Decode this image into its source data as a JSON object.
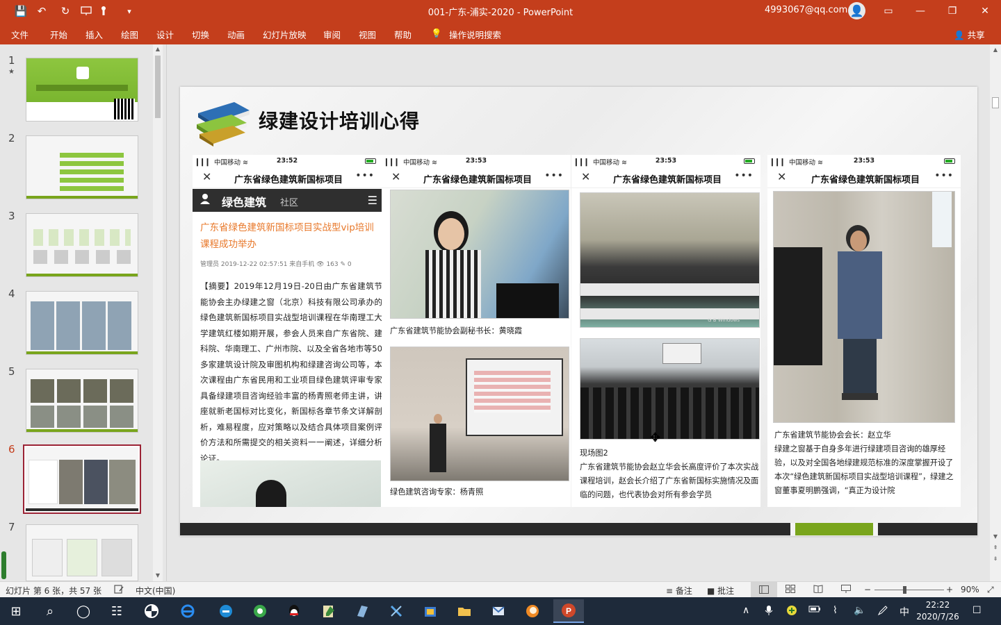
{
  "titlebar": {
    "doc_title": "001-广东-浦实-2020  -  PowerPoint",
    "account": "4993067@qq.com",
    "save_icon": "💾",
    "undo_icon": "↶",
    "redo_icon": "↻",
    "customize_icon": "▾",
    "avatar_glyph": "👤",
    "ribbon_display_icon": "▭",
    "minimize_glyph": "—",
    "restore_glyph": "❐",
    "close_glyph": "✕"
  },
  "ribbon": {
    "tabs": [
      "文件",
      "开始",
      "插入",
      "绘图",
      "设计",
      "切换",
      "动画",
      "幻灯片放映",
      "审阅",
      "视图",
      "帮助"
    ],
    "tell_me": "操作说明搜索",
    "lightbulb_glyph": "💡",
    "share": "共享",
    "share_glyph": "👤"
  },
  "thumbnails": {
    "numbers": [
      "1",
      "2",
      "3",
      "4",
      "5",
      "6",
      "7"
    ],
    "star": "★",
    "active_index": 6
  },
  "slide": {
    "title": "绿建设计培训心得",
    "phones": [
      {
        "carrier": "▎▎▎ 中国移动 ≋",
        "time": "23:52",
        "nav_title": "广东省绿色建筑新国标项目",
        "close": "✕",
        "more": "•••",
        "site_name": "绿色建筑",
        "site_section": "社区",
        "article_title": "广东省绿色建筑新国标项目实战型vip培训课程成功举办",
        "meta": "管理员    2019-12-22 02:57:51   来自手机       👁 163    ✎ 0",
        "body": "【摘要】2019年12月19日-20日由广东省建筑节能协会主办绿建之窗（北京）科技有限公司承办的绿色建筑新国标项目实战型培训课程在华南理工大学建筑红楼如期开展，参会人员来自广东省院、建科院、华南理工、广州市院、以及全省各地市等50多家建筑设计院及审图机构和绿建咨询公司等，本次课程由广东省民用和工业项目绿色建筑评审专家具备绿建项目咨询经验丰富的杨青照老师主讲，讲座就新老国标对比变化，新国标各章节条文详解剖析，难易程度，应对策略以及结合具体项目案例评价方法和所需提交的相关资料一一阐述，详细分析论证。"
      },
      {
        "carrier": "▎▎▎ 中国移动 ≋",
        "time": "23:53",
        "nav_title": "广东省绿色建筑新国标项目",
        "close": "✕",
        "more": "•••",
        "caption1": "广东省建筑节能协会副秘书长：黄晓霞",
        "caption2": "绿色建筑咨询专家：杨青照"
      },
      {
        "carrier": "▎▎▎ 中国移动 ≋",
        "time": "23:53",
        "nav_title": "广东省绿色建筑新国标项目",
        "close": "✕",
        "more": "•••",
        "watermark": "G B Windows",
        "caption1": "现场图2",
        "caption2": "广东省建筑节能协会赵立华会长高度评价了本次实战课程培训，赵会长介绍了广东省新国标实施情况及面临的问题，也代表协会对所有参会学员"
      },
      {
        "carrier": "▎▎▎ 中国移动 ≋",
        "time": "23:53",
        "nav_title": "广东省绿色建筑新国标项目",
        "close": "✕",
        "more": "•••",
        "caption1": "广东省建筑节能协会会长：赵立华",
        "caption2": "绿建之窗基于自身多年进行绿建项目咨询的雄厚经验，以及对全国各地绿建规范标准的深度掌握开设了本次“绿色建筑新国标项目实战型培训课程”，绿建之窗董事夏明鹏强调，“真正为设计院"
      }
    ]
  },
  "statusbar": {
    "slide_info": "幻灯片 第 6 张，共 57 张",
    "language": "中文(中国)",
    "notes": "备注",
    "notes_glyph": "≡",
    "comments": "批注",
    "comments_glyph": "■",
    "zoom": "90%",
    "zoom_minus": "−",
    "zoom_plus": "+",
    "fit_glyph": "⤢"
  },
  "taskbar": {
    "time": "22:22",
    "date": "2020/7/26",
    "ime": "中",
    "start_glyph": "⊞",
    "search_glyph": "⌕",
    "cortana_glyph": "◯",
    "taskview_glyph": "☷",
    "volume_glyph": "🔈",
    "network_glyph": "⌇",
    "notify_glyph": "☐",
    "chevron_glyph": "∧"
  },
  "colors": {
    "accent": "#c43e1c",
    "active_thumb_border": "#9b2335",
    "article_title": "#e8782a",
    "slide_bar_green": "#79a51c"
  }
}
